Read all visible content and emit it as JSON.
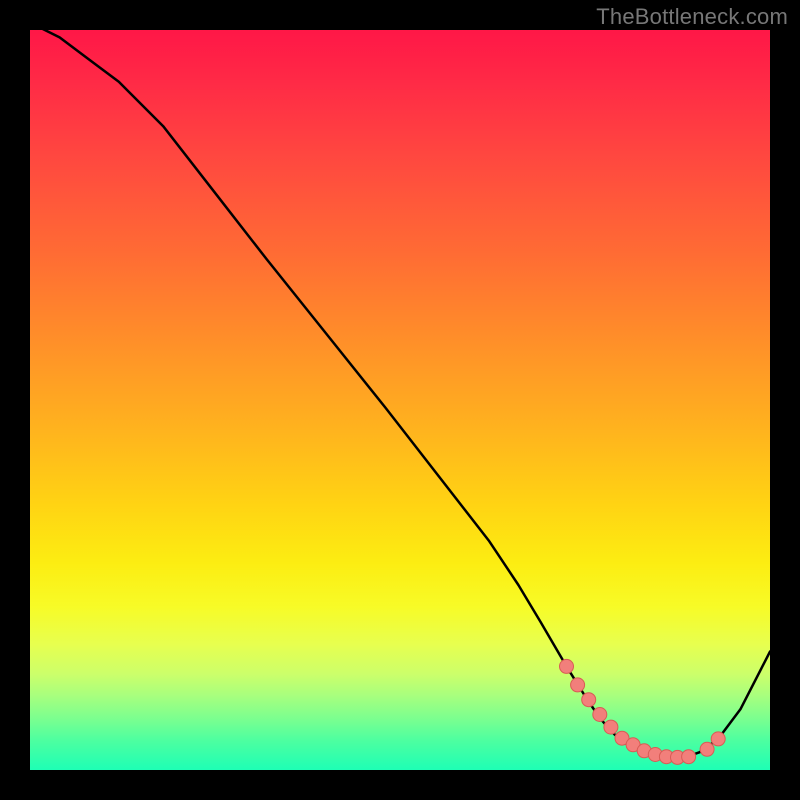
{
  "watermark": {
    "text": "TheBottleneck.com"
  },
  "colors": {
    "curve": "#000000",
    "marker_fill": "#f27f7b",
    "marker_stroke": "#d95b55",
    "grad_top": "#ff1747",
    "grad_bottom": "#1effb5"
  },
  "chart_data": {
    "type": "line",
    "title": "",
    "xlabel": "",
    "ylabel": "",
    "xlim": [
      0,
      100
    ],
    "ylim": [
      0,
      100
    ],
    "legend": false,
    "grid": false,
    "series": [
      {
        "name": "curve",
        "x": [
          0,
          4,
          8,
          12,
          18,
          25,
          32,
          40,
          48,
          55,
          62,
          66,
          69,
          72.5,
          75,
          77,
          79,
          81,
          83,
          85,
          87,
          88.5,
          90.5,
          93,
          96,
          100
        ],
        "y": [
          101,
          99,
          96,
          93,
          87,
          78,
          69,
          59,
          49,
          40,
          31,
          25,
          20,
          14,
          10,
          7,
          4.8,
          3.2,
          2.2,
          1.7,
          1.6,
          1.7,
          2.4,
          4.2,
          8.2,
          16
        ]
      }
    ],
    "markers": {
      "name": "trough-points",
      "x": [
        72.5,
        74.0,
        75.5,
        77.0,
        78.5,
        80.0,
        81.5,
        83.0,
        84.5,
        86.0,
        87.5,
        89.0,
        91.5,
        93.0
      ],
      "y": [
        14.0,
        11.5,
        9.5,
        7.5,
        5.8,
        4.3,
        3.4,
        2.6,
        2.1,
        1.8,
        1.7,
        1.8,
        2.8,
        4.2
      ]
    }
  }
}
